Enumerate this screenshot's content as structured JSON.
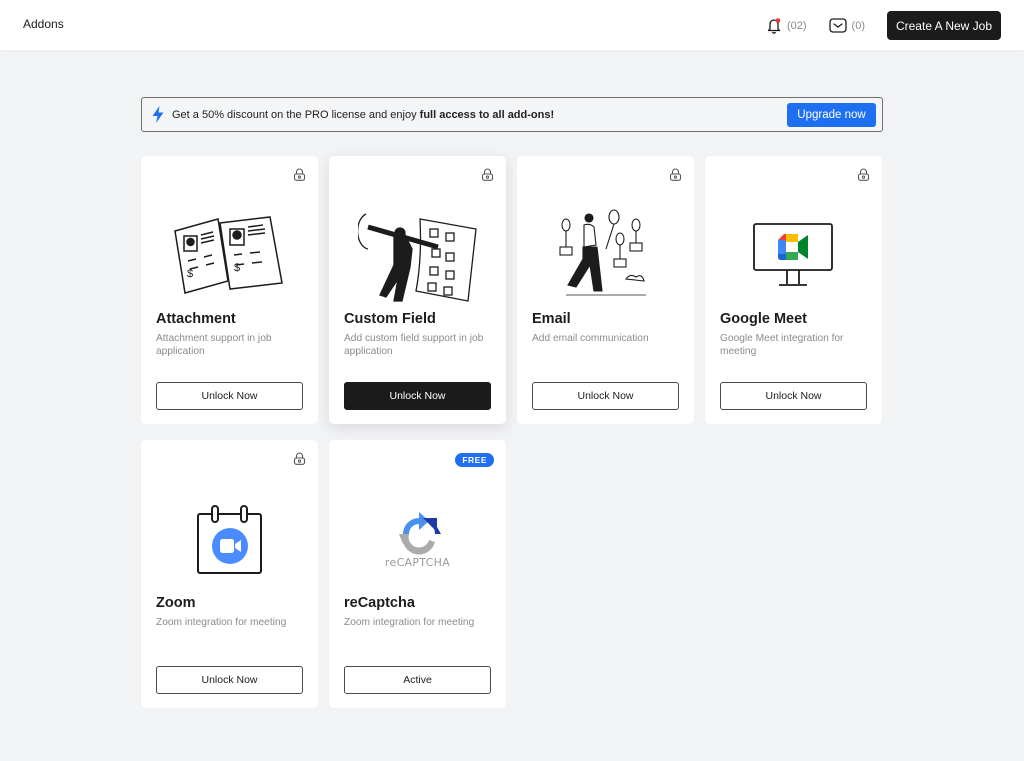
{
  "header": {
    "title": "Addons",
    "notifications_count": "(02)",
    "messages_count": "(0)",
    "create_button": "Create A New Job"
  },
  "banner": {
    "text_prefix": "Get a 50% discount on the PRO license and enjoy ",
    "text_bold": "full access to all add-ons!",
    "button": "Upgrade now",
    "icon": "lightning-bolt-icon"
  },
  "colors": {
    "accent": "#1f6ff2",
    "dark": "#1b1b1b",
    "background": "#f2f3f5"
  },
  "addons": [
    {
      "name": "Attachment",
      "description": "Attachment support in job application",
      "action": "Unlock Now",
      "locked": true,
      "illustration": "resume-documents-illustration"
    },
    {
      "name": "Custom Field",
      "description": "Add custom field support in job application",
      "action": "Unlock Now",
      "locked": true,
      "illustration": "custom-field-form-illustration"
    },
    {
      "name": "Email",
      "description": "Add email communication",
      "action": "Unlock Now",
      "locked": true,
      "illustration": "email-balloons-illustration"
    },
    {
      "name": "Google Meet",
      "description": "Google Meet integration for meeting",
      "action": "Unlock Now",
      "locked": true,
      "illustration": "google-meet-monitor-illustration"
    },
    {
      "name": "Zoom",
      "description": "Zoom integration for meeting",
      "action": "Unlock Now",
      "locked": true,
      "illustration": "zoom-calendar-illustration"
    },
    {
      "name": "reCaptcha",
      "description": "Zoom integration for meeting",
      "action": "Active",
      "locked": false,
      "badge": "FREE",
      "illustration": "recaptcha-logo",
      "logo_text": "reCAPTCHA"
    }
  ]
}
